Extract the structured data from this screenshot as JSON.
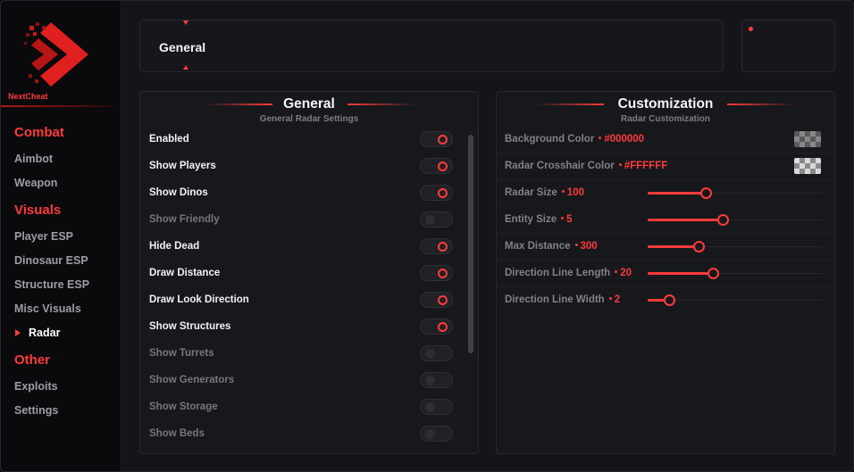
{
  "brand": {
    "name": "NextCheat",
    "accent": "#ff3b3b"
  },
  "sidebar": {
    "sections": [
      {
        "label": "Combat",
        "items": [
          "Aimbot",
          "Weapon"
        ]
      },
      {
        "label": "Visuals",
        "items": [
          "Player ESP",
          "Dinosaur ESP",
          "Structure ESP",
          "Misc Visuals",
          "Radar"
        ]
      },
      {
        "label": "Other",
        "items": [
          "Exploits",
          "Settings"
        ]
      }
    ],
    "active_item": "Radar"
  },
  "top_panel": {
    "title": "General"
  },
  "general_panel": {
    "title": "General",
    "subtitle": "General Radar Settings",
    "options": [
      {
        "label": "Enabled",
        "on": true
      },
      {
        "label": "Show Players",
        "on": true
      },
      {
        "label": "Show Dinos",
        "on": true
      },
      {
        "label": "Show Friendly",
        "on": false
      },
      {
        "label": "Hide Dead",
        "on": true
      },
      {
        "label": "Draw Distance",
        "on": true
      },
      {
        "label": "Draw Look Direction",
        "on": true
      },
      {
        "label": "Show Structures",
        "on": true
      },
      {
        "label": "Show Turrets",
        "on": false
      },
      {
        "label": "Show Generators",
        "on": false
      },
      {
        "label": "Show Storage",
        "on": false
      },
      {
        "label": "Show Beds",
        "on": false
      }
    ]
  },
  "custom_panel": {
    "title": "Customization",
    "subtitle": "Radar Customization",
    "colors": [
      {
        "label": "Background Color",
        "value": "#000000"
      },
      {
        "label": "Radar Crosshair Color",
        "value": "#FFFFFF"
      }
    ],
    "sliders": [
      {
        "label": "Radar Size",
        "value": "100",
        "fraction": 0.33
      },
      {
        "label": "Entity Size",
        "value": "5",
        "fraction": 0.43
      },
      {
        "label": "Max Distance",
        "value": "300",
        "fraction": 0.29
      },
      {
        "label": "Direction Line Length",
        "value": "20",
        "fraction": 0.37
      },
      {
        "label": "Direction Line Width",
        "value": "2",
        "fraction": 0.12
      }
    ]
  }
}
